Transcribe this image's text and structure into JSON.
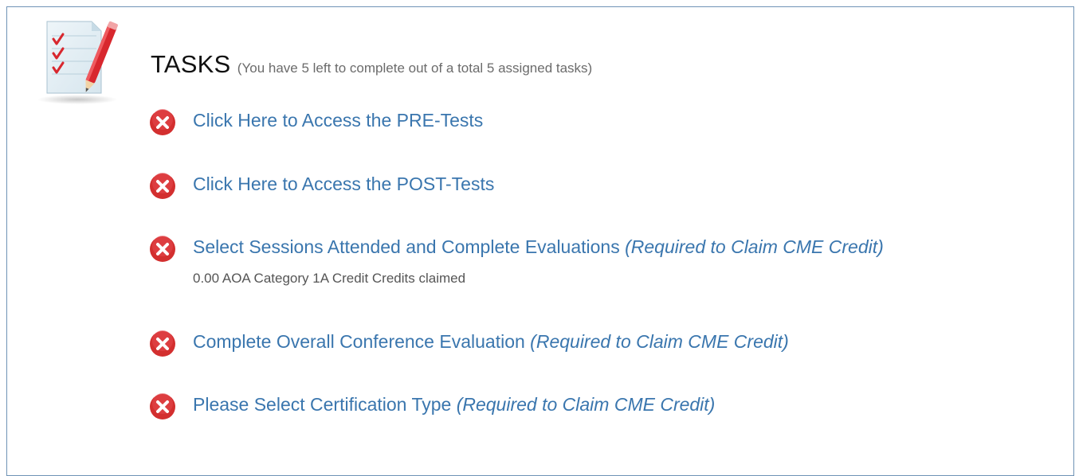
{
  "header": {
    "title": "TASKS",
    "subtitle": "(You have 5 left to complete out of a total 5 assigned tasks)"
  },
  "icons": {
    "header_icon": "checklist-notebook-with-pencil",
    "status_icon": "red-circle-x",
    "status_color": "#d32f2f",
    "link_color": "#3a76ae"
  },
  "tasks": [
    {
      "label": "Click Here to Access the PRE-Tests",
      "required": "",
      "status": "incomplete"
    },
    {
      "label": "Click Here to Access the POST-Tests",
      "required": "",
      "status": "incomplete"
    },
    {
      "label": "Select Sessions Attended and Complete Evaluations",
      "required": "(Required to Claim CME Credit)",
      "note": "0.00 AOA Category 1A Credit Credits claimed",
      "status": "incomplete"
    },
    {
      "label": "Complete Overall Conference Evaluation",
      "required": "(Required to Claim CME Credit)",
      "status": "incomplete"
    },
    {
      "label": "Please Select Certification Type",
      "required": "(Required to Claim CME Credit)",
      "status": "incomplete"
    }
  ]
}
